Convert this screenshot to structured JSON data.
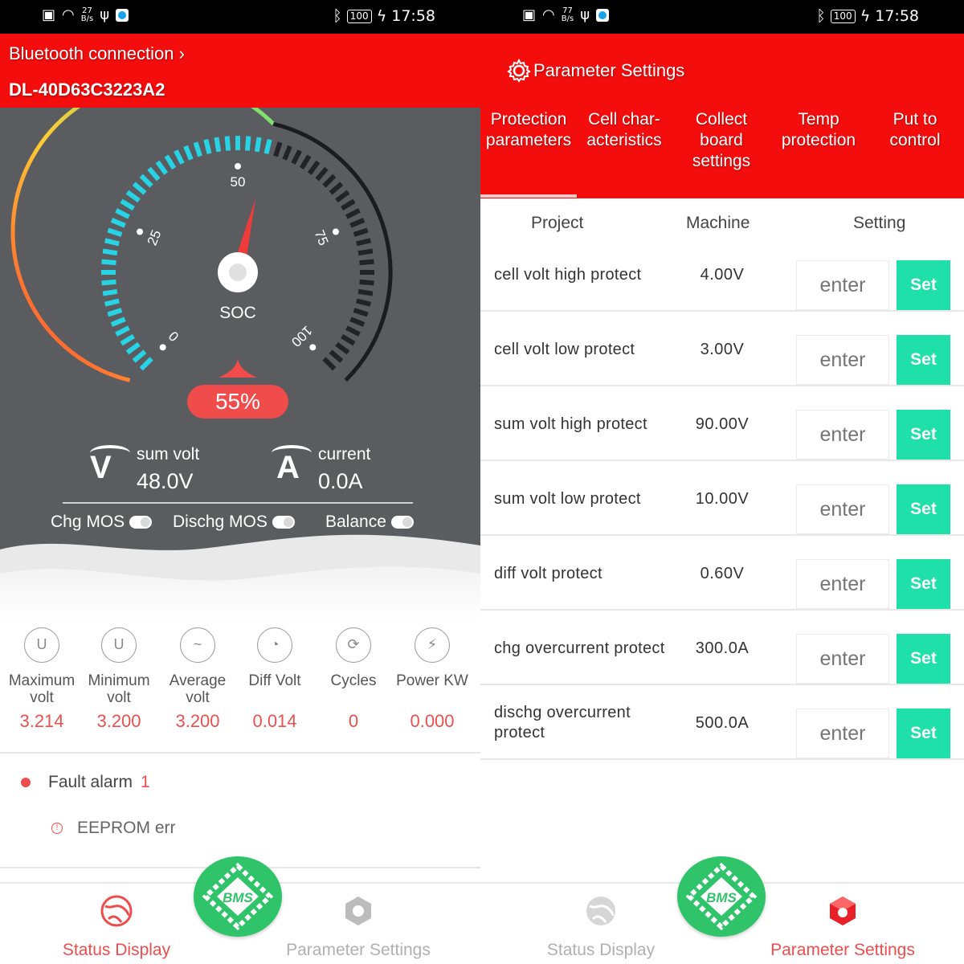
{
  "status_bar": {
    "time": "17:58",
    "battery": "100",
    "left_speed_top": "27",
    "left_speed_unit": "B/s",
    "right_speed_top": "77",
    "right_speed_unit": "B/s"
  },
  "status_display": {
    "bluetooth_label": "Bluetooth connection",
    "device_id": "DL-40D63C3223A2",
    "gauge": {
      "label": "SOC",
      "ticks": [
        "0",
        "25",
        "50",
        "75",
        "100"
      ],
      "percent_text": "55%",
      "soc_value": 55
    },
    "sum_volt": {
      "label": "sum volt",
      "value": "48.0V",
      "symbol": "V"
    },
    "current": {
      "label": "current",
      "value": "0.0A",
      "symbol": "A"
    },
    "toggles": [
      "Chg MOS",
      "Dischg MOS",
      "Balance"
    ],
    "stats": [
      {
        "name": "Maximum volt",
        "value": "3.214",
        "icon": "U"
      },
      {
        "name": "Minimum volt",
        "value": "3.200",
        "icon": "U"
      },
      {
        "name": "Average volt",
        "value": "3.200",
        "icon": "~"
      },
      {
        "name": "Diff Volt",
        "value": "0.014",
        "icon": "◔"
      },
      {
        "name": "Cycles",
        "value": "0",
        "icon": "⟳"
      },
      {
        "name": "Power KW",
        "value": "0.000",
        "icon": "⚡"
      }
    ],
    "fault": {
      "label": "Fault alarm",
      "count": "1",
      "item": "EEPROM err"
    }
  },
  "nav": {
    "status": "Status Display",
    "params": "Parameter Settings",
    "center": "BMS",
    "active_color": "#ef4d4d",
    "inactive_color": "#b0b0b0"
  },
  "parameter_settings": {
    "title": "Parameter Settings",
    "tabs": [
      {
        "line1": "Protection",
        "line2": "parameters"
      },
      {
        "line1": "Cell char-",
        "line2": "acteristics"
      },
      {
        "line1": "Collect",
        "line2": "board",
        "line3": "settings"
      },
      {
        "line1": "Temp",
        "line2": "protection"
      },
      {
        "line1": "Put to",
        "line2": "control"
      }
    ],
    "headers": {
      "project": "Project",
      "machine": "Machine",
      "setting": "Setting"
    },
    "placeholder": "enter",
    "set_label": "Set",
    "rows": [
      {
        "name": "cell volt high protect",
        "machine": "4.00V"
      },
      {
        "name": "cell volt low protect",
        "machine": "3.00V"
      },
      {
        "name": "sum volt high protect",
        "machine": "90.00V"
      },
      {
        "name": "sum volt low protect",
        "machine": "10.00V"
      },
      {
        "name": "diff volt protect",
        "machine": "0.60V"
      },
      {
        "name": "chg overcurrent protect",
        "machine": "300.0A"
      },
      {
        "name": "dischg overcurrent protect",
        "machine": "500.0A"
      }
    ]
  },
  "colors": {
    "header_red": "#f40d0d",
    "value_red": "#e9514f",
    "set_green": "#1ee0a8",
    "bms_green": "#2fc36a",
    "gauge_bg": "#5a5c60"
  }
}
